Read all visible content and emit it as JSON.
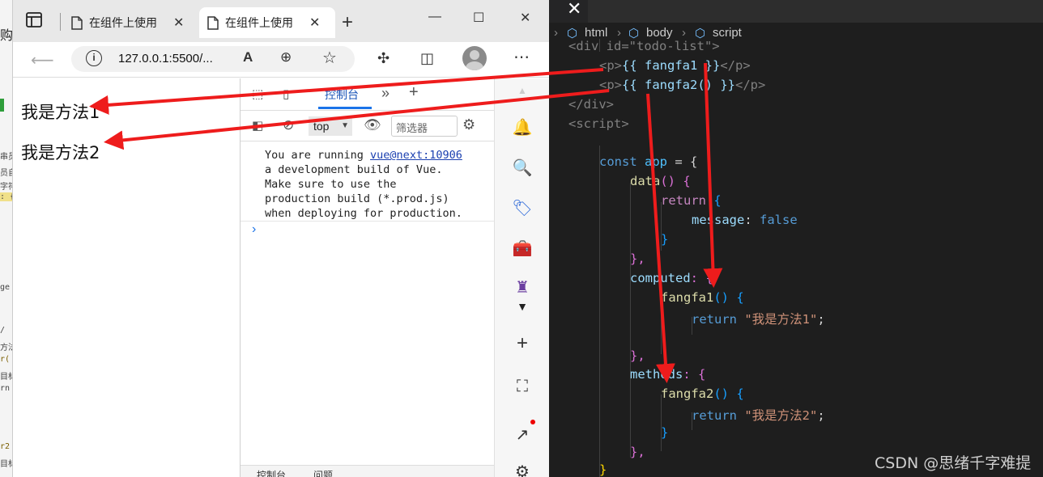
{
  "left_window": {
    "sliver_fragments": [
      "购",
      "串员",
      "员自",
      "字符",
      ": {",
      "ge",
      "/",
      "方法",
      "r(",
      "目标",
      "rn",
      "r2",
      "目标"
    ]
  },
  "browser": {
    "tabs": [
      {
        "title": "在组件上使用",
        "close": "✕",
        "active": false
      },
      {
        "title": "在组件上使用",
        "close": "✕",
        "active": true
      }
    ],
    "new_tab": "+",
    "window_controls": {
      "minimize": "—",
      "maximize": "☐",
      "close": "✕"
    },
    "address": "127.0.0.1:5500/...",
    "page_lines": [
      "我是方法1",
      "我是方法2"
    ],
    "devtools": {
      "console_tab": "控制台",
      "context": "top",
      "filter_placeholder": "筛选器",
      "message_before_link": "You are running ",
      "message_link": "vue@next:10906",
      "message_after_link": "\na development build of Vue.\nMake sure to use the\nproduction build (*.prod.js)\nwhen deploying for production.",
      "prompt": "›",
      "drawer_tabs": [
        "控制台",
        "问题"
      ]
    }
  },
  "editor": {
    "close": "✕",
    "breadcrumb": [
      "html",
      "body",
      "script"
    ],
    "lines": {
      "l0": "<div id=\"todo-list\">",
      "l1_open": "<p>",
      "l1_expr": "{{ fangfa1 }}",
      "l1_close": "</p>",
      "l2_open": "<p>",
      "l2_expr": "{{ fangfa2() }}",
      "l2_close": "</p>",
      "l3": "</div>",
      "l4": "<script>",
      "l6_kw": "const",
      "l6_var": "app",
      "l6_rest": " = {",
      "l7_fn": "data",
      "l7_rest": "() {",
      "l8_kw": "return",
      "l8_rest": " {",
      "l9_key": "message",
      "l9_colon": ": ",
      "l9_val": "false",
      "l10": "}",
      "l11": "},",
      "l12_key": "computed",
      "l12_rest": ": {",
      "l13_fn": "fangfa1",
      "l13_rest": "() {",
      "l14_kw": "return",
      "l14_str": "\"我是方法1\"",
      "l14_end": ";",
      "l16": "},",
      "l17_key": "methods",
      "l17_rest": ": {",
      "l18_fn": "fangfa2",
      "l18_rest": "() {",
      "l19_kw": "return",
      "l19_str": "\"我是方法2\"",
      "l19_end": ";",
      "l20": "}",
      "l21": "},",
      "l22": "}"
    },
    "watermark": "CSDN @思绪千字难提"
  },
  "colors": {
    "annotation_arrow": "#ee1c1c",
    "editor_bg": "#1e1e1e",
    "devtools_accent": "#1a73e8"
  }
}
